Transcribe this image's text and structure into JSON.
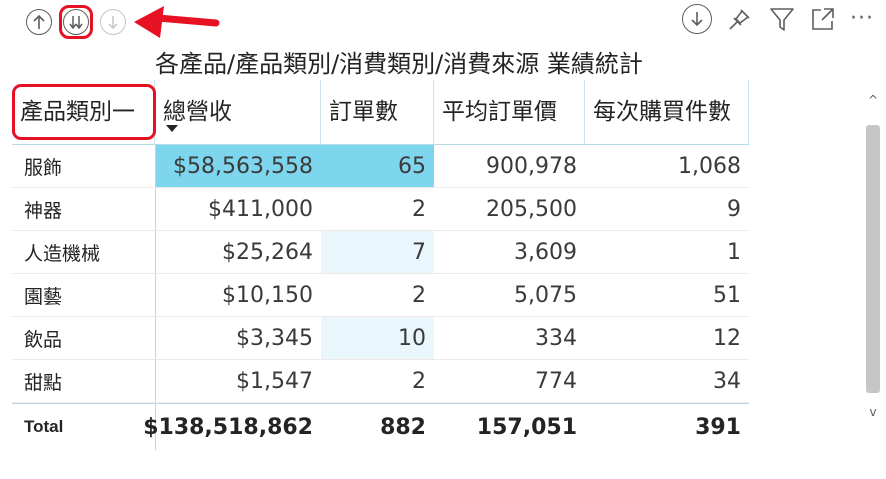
{
  "title": "各產品/產品類別/消費類別/消費來源 業績統計",
  "toolbar_left": {
    "icons": [
      "arrow-up-icon",
      "double-arrow-down-icon",
      "expand-all-icon"
    ]
  },
  "toolbar_right": {
    "icons": [
      "drill-down-icon",
      "pin-icon",
      "filter-icon",
      "focus-mode-icon",
      "more-options-icon"
    ],
    "more_label": "···"
  },
  "table": {
    "columns": [
      "產品類別一",
      "總營收",
      "訂單數",
      "平均訂單價",
      "每次購買件數"
    ],
    "rows": [
      [
        "服飾",
        "$58,563,558",
        "65",
        "900,978",
        "1,068"
      ],
      [
        "神器",
        "$411,000",
        "2",
        "205,500",
        "9"
      ],
      [
        "人造機械",
        "$25,264",
        "7",
        "3,609",
        "1"
      ],
      [
        "園藝",
        "$10,150",
        "2",
        "5,075",
        "51"
      ],
      [
        "飲品",
        "$3,345",
        "10",
        "334",
        "12"
      ],
      [
        "甜點",
        "$1,547",
        "2",
        "774",
        "34"
      ]
    ],
    "total": [
      "Total",
      "$138,518,862",
      "882",
      "157,051",
      "391"
    ],
    "bar_colors": {
      "rev_top": "#7ed6ee",
      "orders_top": "#7ed6ee",
      "orders_light": "#e9f7fc"
    }
  },
  "scrollbar": {
    "up": "^",
    "down": "v"
  },
  "colors": {
    "highlight": "#e81123",
    "accent": "#7ed6ee"
  }
}
